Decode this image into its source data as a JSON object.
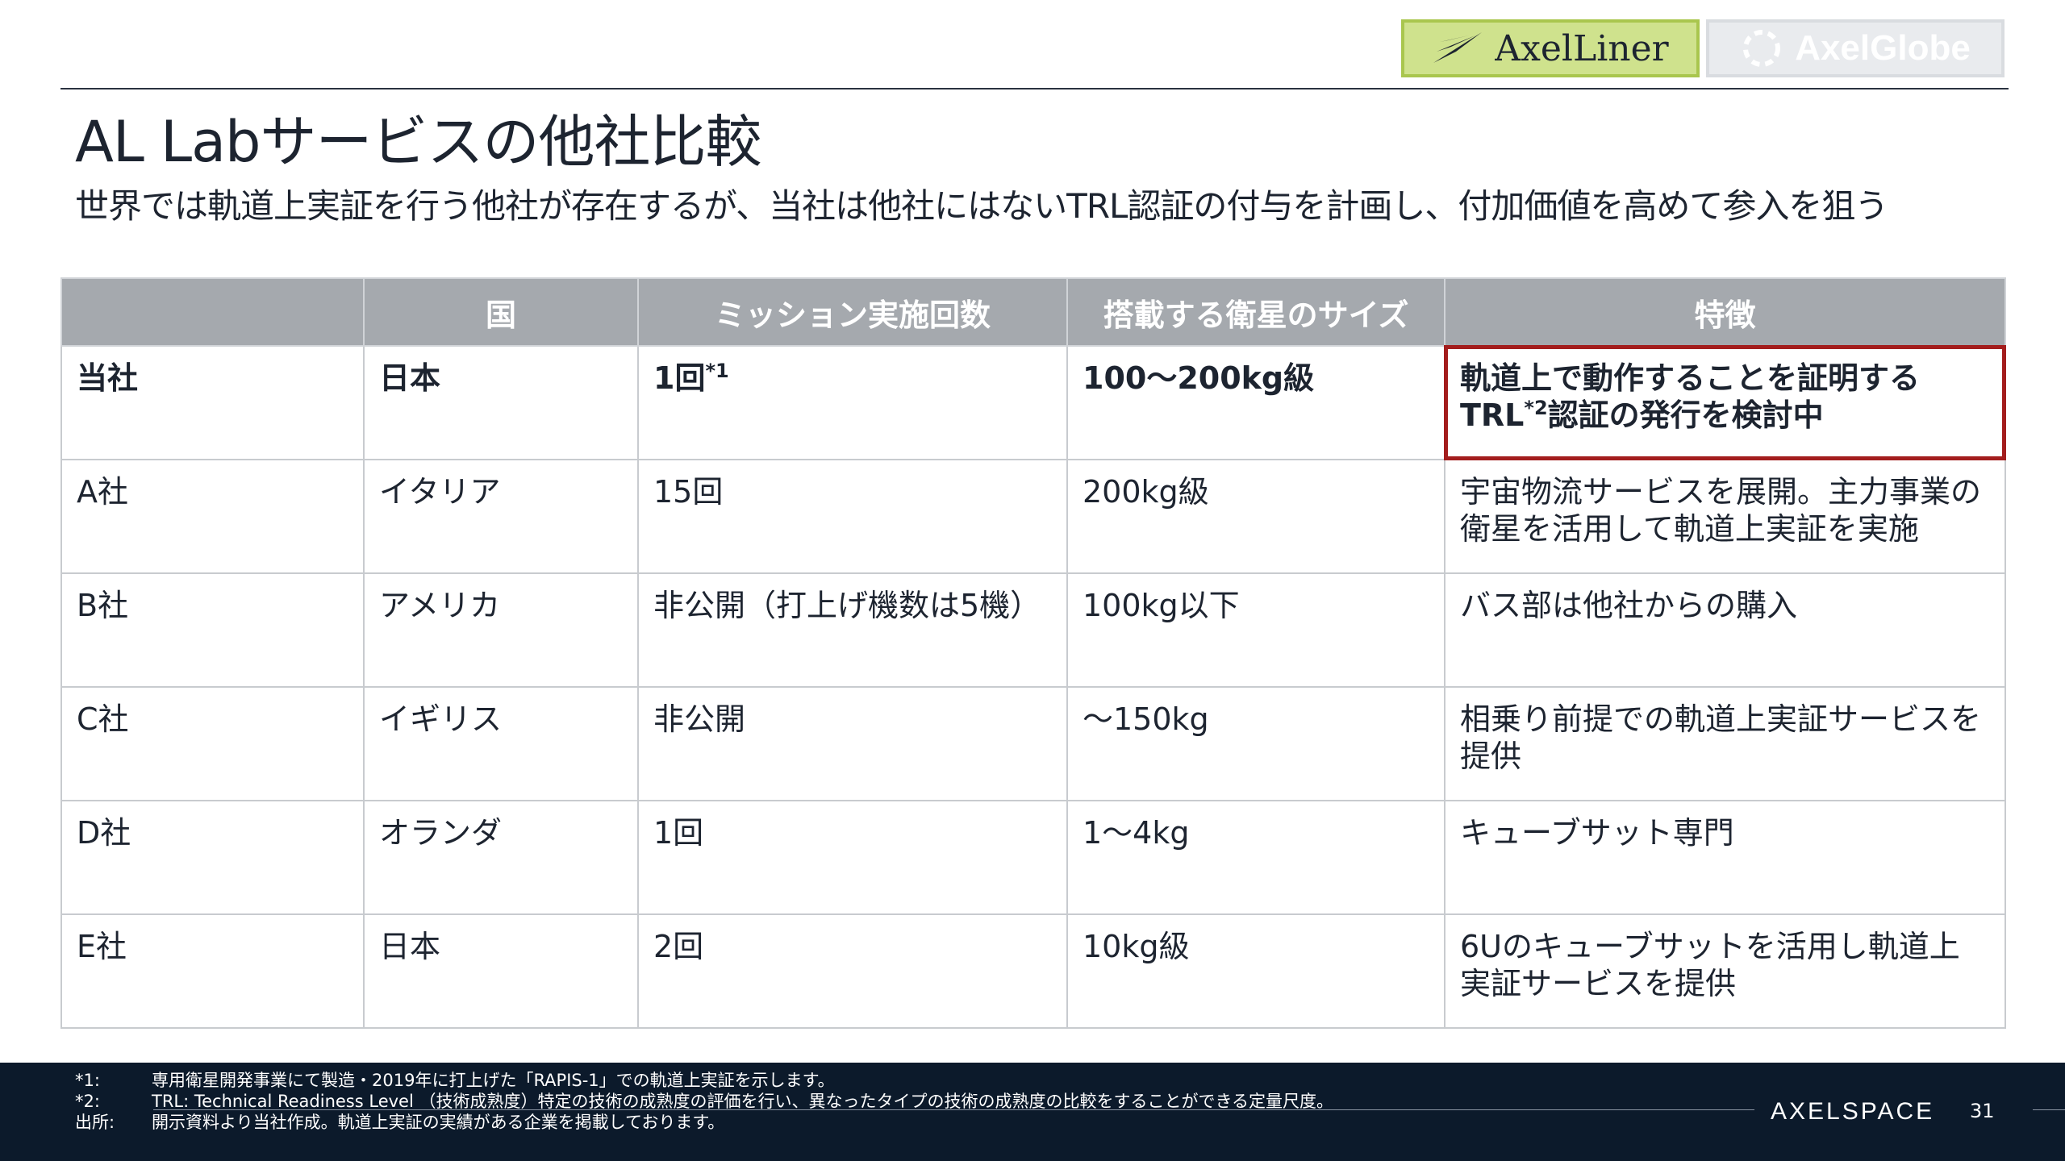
{
  "brand_tabs": [
    {
      "label": "AxelLiner",
      "icon": "axelliner-logo-icon"
    },
    {
      "label": "AxelGlobe",
      "icon": "axelglobe-logo-icon"
    }
  ],
  "title": "AL Labサービスの他社比較",
  "subtitle": "世界では軌道上実証を行う他社が存在するが、当社は他社にはないTRL認証の付与を計画し、付加価値を高めて参入を狙う",
  "table": {
    "headers": [
      "",
      "国",
      "ミッション実施回数",
      "搭載する衛星のサイズ",
      "特徴"
    ],
    "ours": {
      "company": "当社",
      "country": "日本",
      "missions": "1回",
      "missions_note": "*1",
      "size": "100〜200kg級",
      "feature_line1": "軌道上で動作することを証明する",
      "feature_pre": "TRL",
      "feature_note": "*2",
      "feature_post": "認証の発行を検討中"
    },
    "rows": [
      {
        "company": "A社",
        "country": "イタリア",
        "missions": "15回",
        "size": "200kg級",
        "feature": "宇宙物流サービスを展開。主力事業の衛星を活用して軌道上実証を実施"
      },
      {
        "company": "B社",
        "country": "アメリカ",
        "missions": "非公開（打上げ機数は5機）",
        "size": "100kg以下",
        "feature": "バス部は他社からの購入"
      },
      {
        "company": "C社",
        "country": "イギリス",
        "missions": "非公開",
        "size": "〜150kg",
        "feature": "相乗り前提での軌道上実証サービスを提供"
      },
      {
        "company": "D社",
        "country": "オランダ",
        "missions": "1回",
        "size": "1〜4kg",
        "feature": "キューブサット専門"
      },
      {
        "company": "E社",
        "country": "日本",
        "missions": "2回",
        "size": "10kg級",
        "feature": "6Uのキューブサットを活用し軌道上実証サービスを提供"
      }
    ]
  },
  "footnotes": [
    {
      "mark": "*1:",
      "text": "専用衛星開発事業にて製造・2019年に打上げた「RAPIS-1」での軌道上実証を示します。"
    },
    {
      "mark": "*2:",
      "text": "TRL: Technical Readiness Level （技術成熟度）特定の技術の成熟度の評価を行い、異なったタイプの技術の成熟度の比較をすることができる定量尺度。"
    },
    {
      "mark": "出所:",
      "text": "開示資料より当社作成。軌道上実証の実績がある企業を掲載しております。"
    }
  ],
  "footer": {
    "logo": "AXELSPACE",
    "page_number": "31"
  },
  "colors": {
    "highlight_border": "#a31d1d",
    "header_bg": "#a5a9ae",
    "footer_bg": "#0c1a2b",
    "active_tab": "#cfe28d"
  }
}
